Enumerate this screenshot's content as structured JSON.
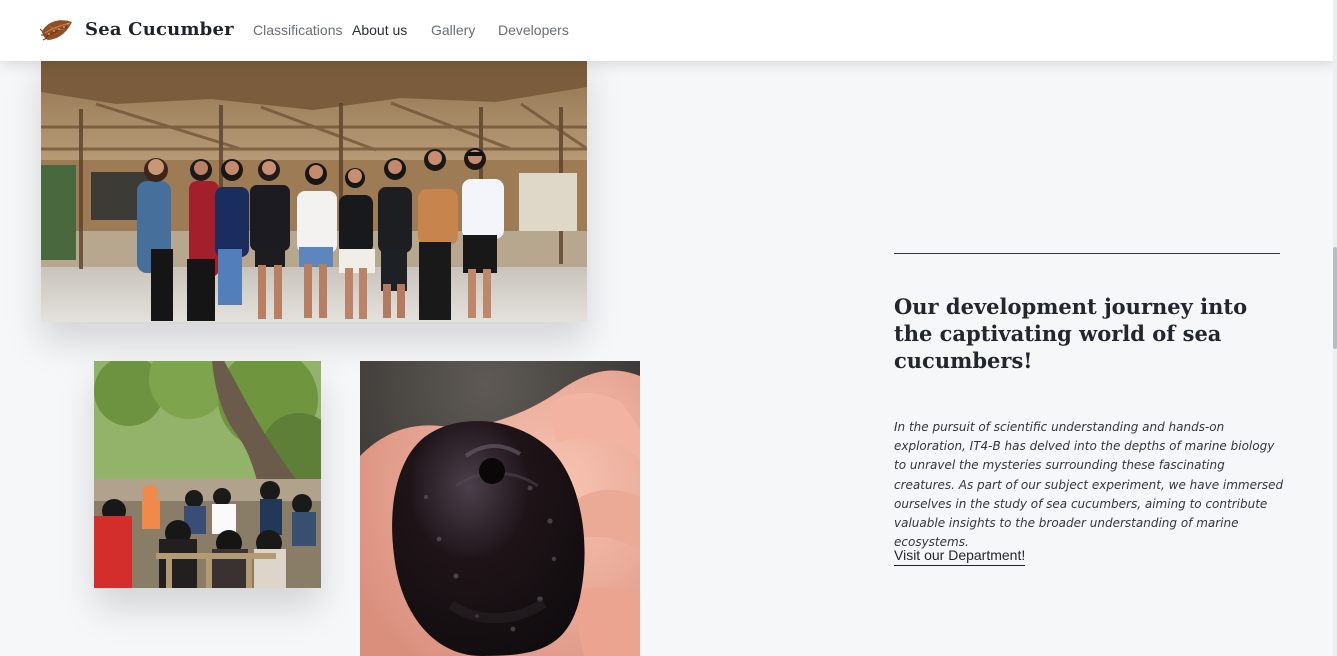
{
  "navbar": {
    "brand_name": "Sea Cucumber",
    "brand_icon": "sea-cucumber-logo-icon",
    "links": [
      {
        "label": "Classifications",
        "active": false
      },
      {
        "label": "About us",
        "active": true
      },
      {
        "label": "Gallery",
        "active": false
      },
      {
        "label": "Developers",
        "active": false
      }
    ]
  },
  "main": {
    "headline": "Our development journey into the captivating world of sea cucumbers!",
    "description": "In the pursuit of scientific understanding and hands-on exploration, IT4-B has delved into the depths of marine biology to unravel the mysteries surrounding these fascinating creatures. As part of our subject experiment, we have immersed ourselves in the study of sea cucumbers, aiming to contribute valuable insights to the broader understanding of marine ecosystems.",
    "cta_label": "Visit our Department!"
  },
  "images": {
    "group_photo": "group-photo",
    "field_photo": "field-photo",
    "cucumber_photo": "sea-cucumber-photo"
  },
  "colors": {
    "background": "#f6f7f9",
    "text": "#1f2328",
    "nav_muted": "#6a6f75"
  }
}
